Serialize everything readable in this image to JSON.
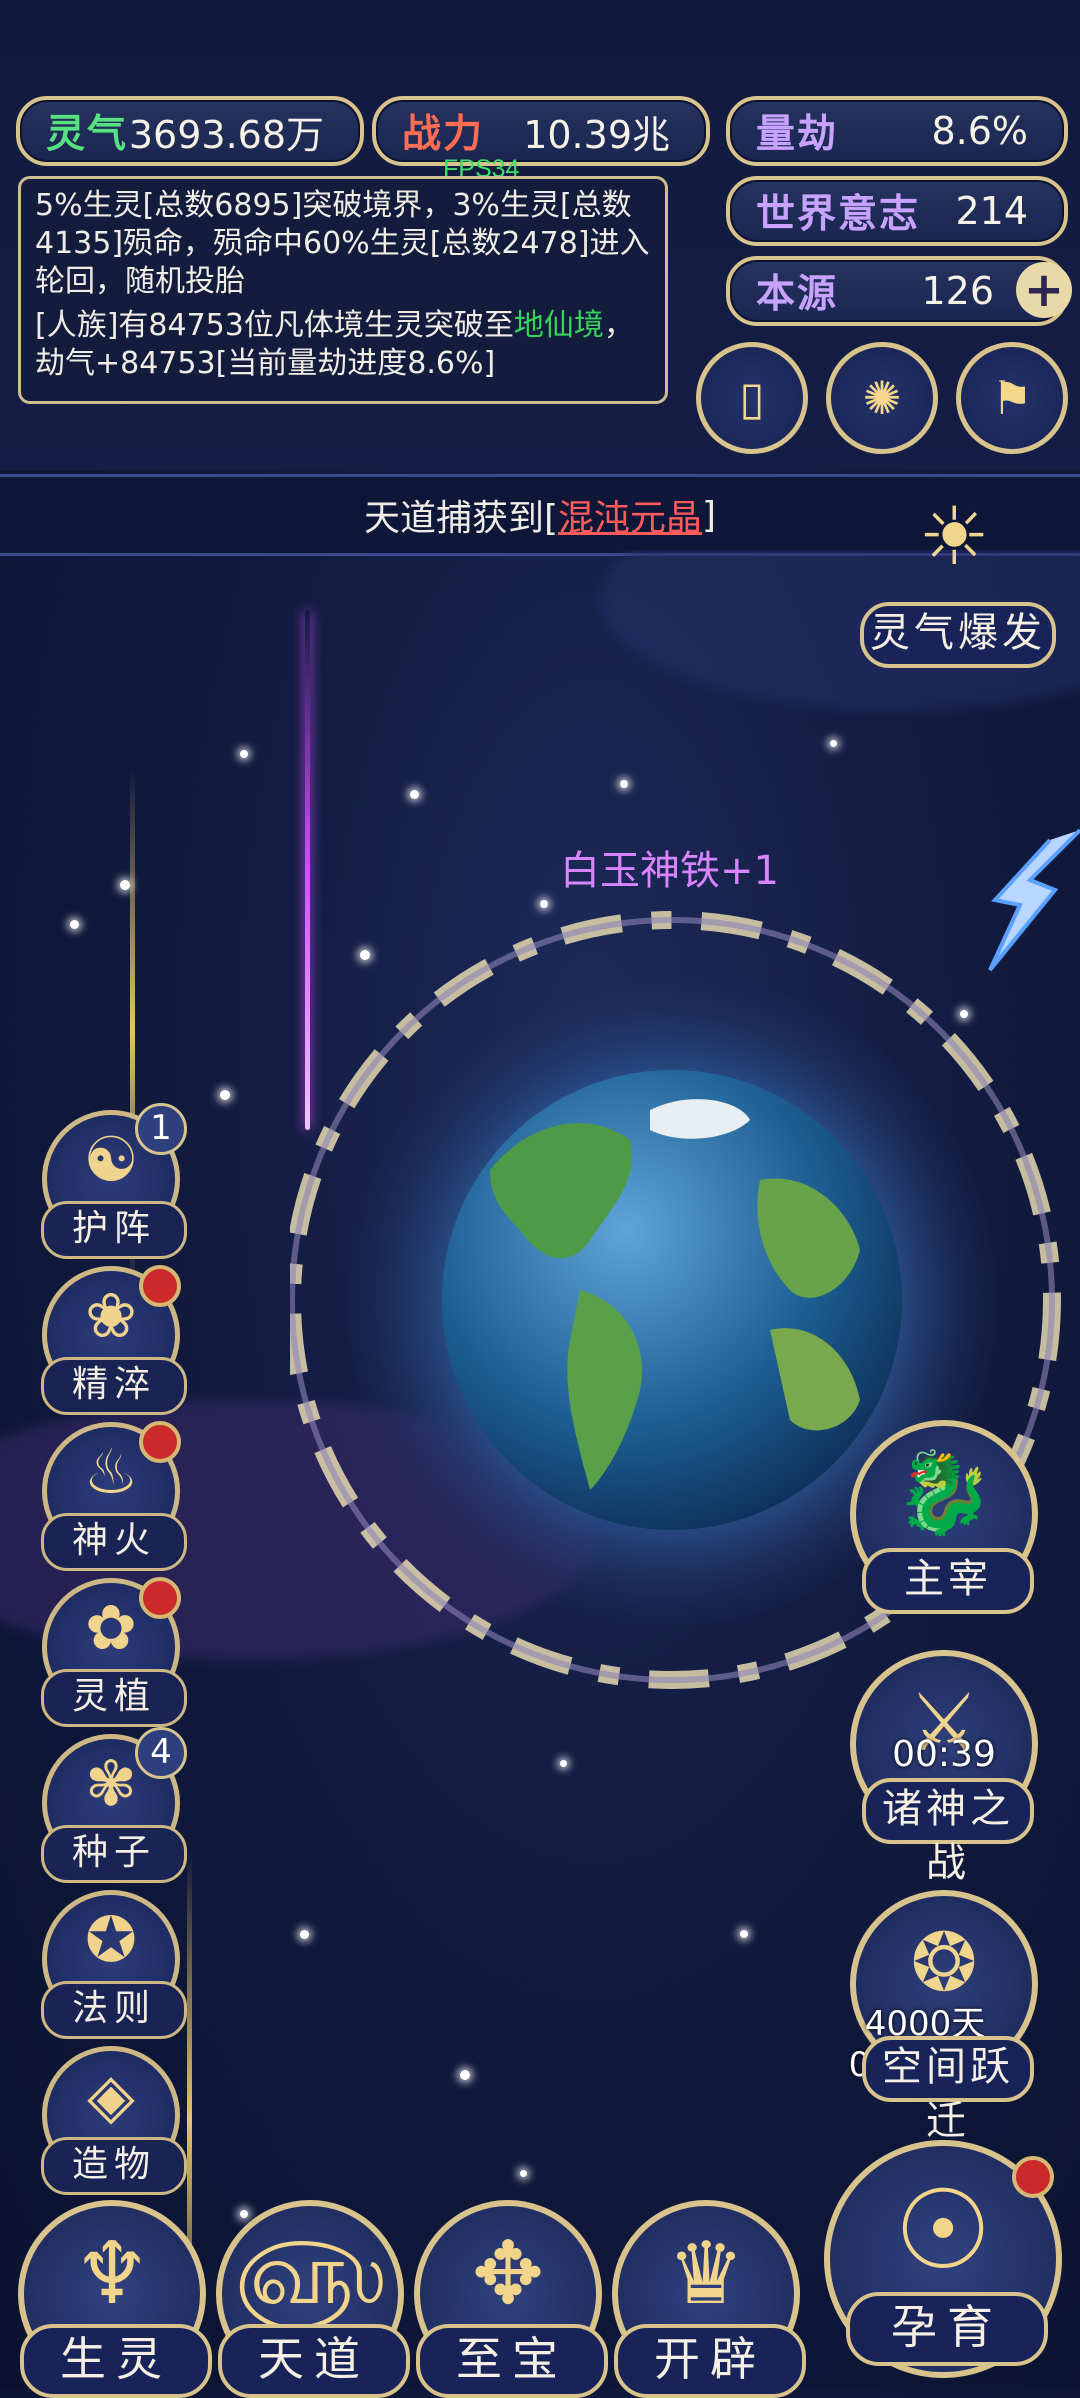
{
  "stats": {
    "lingqi": {
      "label": "灵气",
      "value": "3693.68万"
    },
    "zhanli": {
      "label": "战力",
      "value": "10.39兆"
    },
    "liangjie": {
      "label": "量劫",
      "value": "8.6%"
    },
    "shijie": {
      "label": "世界意志",
      "value": "214"
    },
    "benyuan": {
      "label": "本源",
      "value": "126"
    }
  },
  "fps": "FPS34",
  "log": {
    "line1": "5%生灵[总数6895]突破境界，3%生灵[总数4135]殒命，殒命中60%生灵[总数2478]进入轮回，随机投胎",
    "line2_pre": "[人族]有84753位凡体境生灵突破至",
    "line2_hl": "地仙境",
    "line2_post": "，劫气+84753[当前量劫进度8.6%]"
  },
  "top_icons": [
    "card-icon",
    "vortex-icon",
    "scroll-icon"
  ],
  "banner": {
    "prefix": "天道捕获到[",
    "item": "混沌元晶",
    "suffix": "]"
  },
  "lingqi_burst": "灵气爆发",
  "float_text": "白玉神铁+1",
  "left_menu": [
    {
      "name": "护阵",
      "icon": "yin-yang-icon",
      "badge": "1"
    },
    {
      "name": "精淬",
      "icon": "lotus-icon",
      "dot": true
    },
    {
      "name": "神火",
      "icon": "flame-icon",
      "dot": true
    },
    {
      "name": "灵植",
      "icon": "plant-icon",
      "dot": true
    },
    {
      "name": "种子",
      "icon": "flower-icon",
      "badge": "4"
    },
    {
      "name": "法则",
      "icon": "rune-icon"
    },
    {
      "name": "造物",
      "icon": "diamond-icon"
    }
  ],
  "right_menu": {
    "zhuzai": "主宰",
    "zhushen": {
      "name": "诸神之战",
      "timer": "00:39"
    },
    "kongjian": {
      "name": "空间跃迁",
      "timer": "4000天00:05:17"
    },
    "yunyu": "孕育"
  },
  "bottom_menu": [
    "生灵",
    "天道",
    "至宝",
    "开辟"
  ],
  "colors": {
    "gold": "#d8c38d",
    "highlight_green": "#38d35c",
    "item_red": "#ff5b5b",
    "float_purple": "#d985ff"
  }
}
